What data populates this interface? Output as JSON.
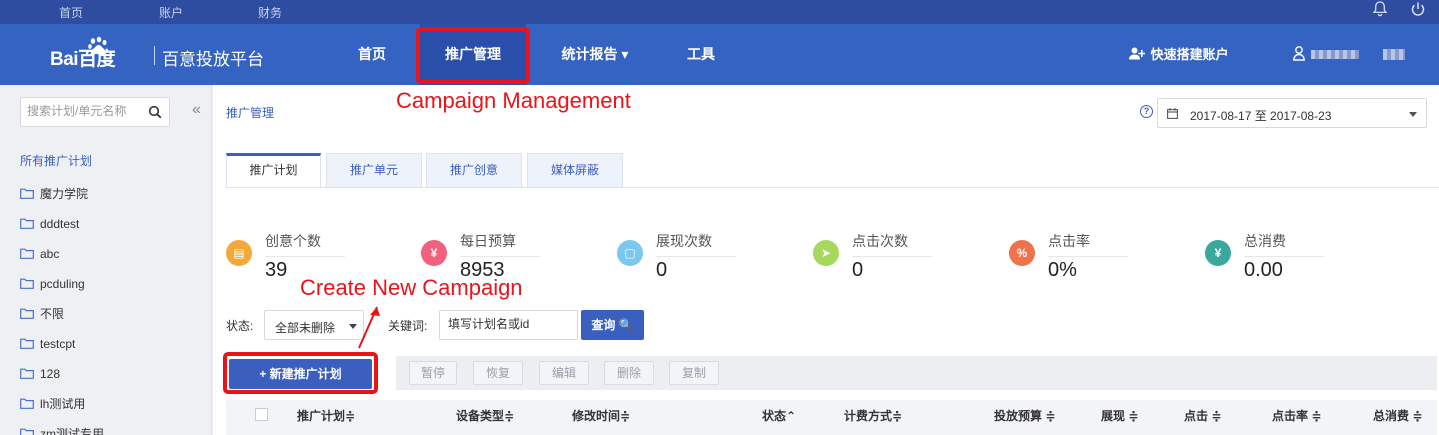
{
  "topbar": {
    "links": [
      "首页",
      "账户",
      "财务"
    ],
    "icons": [
      "bell-icon",
      "power-icon"
    ]
  },
  "header": {
    "logo_text": "Bai百度",
    "platform": "百意投放平台",
    "nav": [
      {
        "label": "首页"
      },
      {
        "label": "推广管理",
        "active": true
      },
      {
        "label": "统计报告 ▾"
      },
      {
        "label": "工具"
      }
    ],
    "quick_create": "快速搭建账户"
  },
  "sidebar": {
    "search_placeholder": "搜索计划/单元名称",
    "collapse_glyph": "«",
    "all_plans": "所有推广计划",
    "items": [
      "魔力学院",
      "dddtest",
      "abc",
      "pcduling",
      "不限",
      "testcpt",
      "128",
      "lh测试用",
      "zm测试专用"
    ]
  },
  "main": {
    "breadcrumb": "推广管理",
    "date_range": "2017-08-17 至 2017-08-23",
    "tabs": [
      "推广计划",
      "推广单元",
      "推广创意",
      "媒体屏蔽"
    ],
    "stats": [
      {
        "label": "创意个数",
        "value": "39",
        "icon": "▤",
        "color": "#f2a83b"
      },
      {
        "label": "每日预算",
        "value": "8953",
        "icon": "¥",
        "color": "#f2607e"
      },
      {
        "label": "展现次数",
        "value": "0",
        "icon": "▢",
        "color": "#7ac8ee"
      },
      {
        "label": "点击次数",
        "value": "0",
        "icon": "➤",
        "color": "#a6d85c"
      },
      {
        "label": "点击率",
        "value": "0%",
        "icon": "%",
        "color": "#f0724a"
      },
      {
        "label": "总消费",
        "value": "0.00",
        "icon": "¥",
        "color": "#38a99a"
      }
    ],
    "filter": {
      "status_label": "状态:",
      "status_value": "全部未删除",
      "keyword_label": "关键词:",
      "keyword_placeholder": "填写计划名或id",
      "query_button": "查询 🔍"
    },
    "new_plan_button": "+ 新建推广计划",
    "actions": [
      "暂停",
      "恢复",
      "编辑",
      "删除",
      "复制"
    ],
    "columns": [
      "推广计划≑",
      "设备类型≑",
      "修改时间≑",
      "状态⌃",
      "计费方式≑",
      "投放预算 ≑",
      "展现 ≑",
      "点击 ≑",
      "点击率 ≑",
      "总消费 ≑"
    ]
  },
  "annotations": {
    "campaign_management": "Campaign Management",
    "create_new_campaign": "Create New Campaign",
    "highlight_color": "#e8141a"
  }
}
